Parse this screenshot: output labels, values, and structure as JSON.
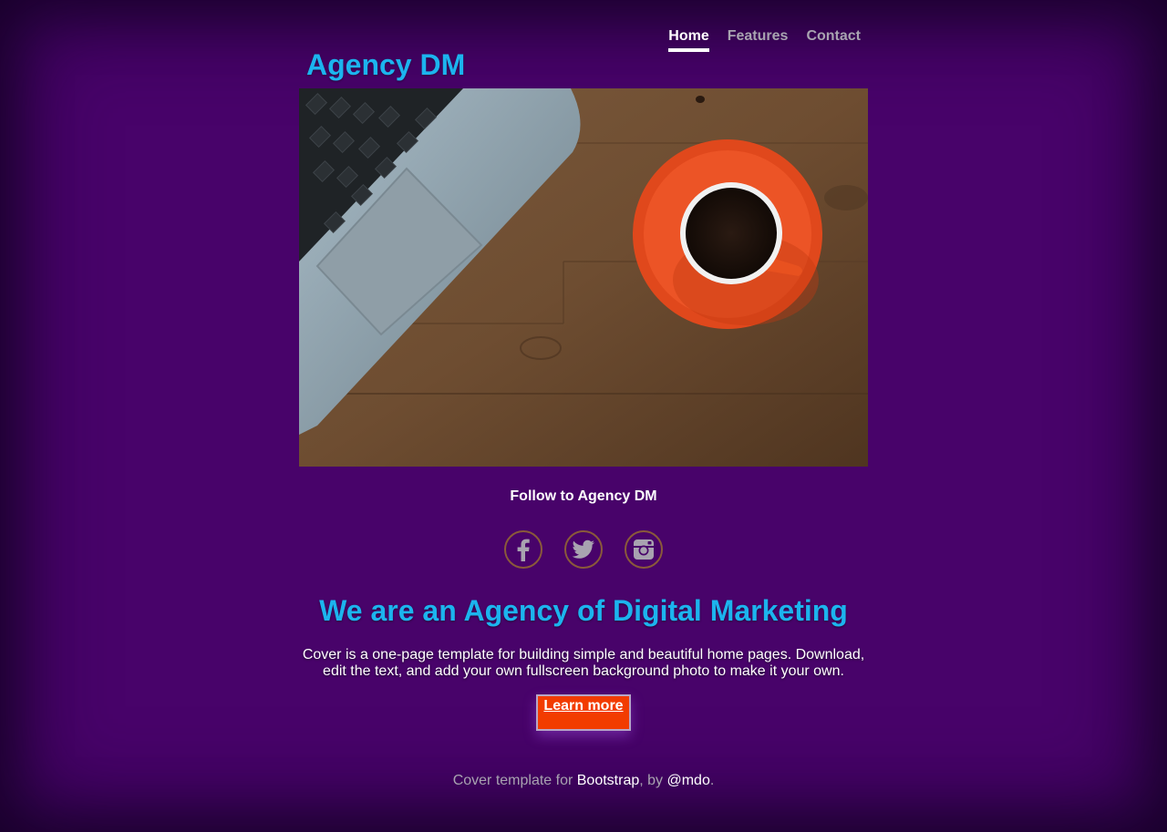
{
  "brand": {
    "name": "Agency DM",
    "color": "#1cb4ee"
  },
  "nav": {
    "items": [
      {
        "label": "Home",
        "active": true
      },
      {
        "label": "Features",
        "active": false
      },
      {
        "label": "Contact",
        "active": false
      }
    ]
  },
  "hero": {
    "image_description_icon": "laptop-coffee-photo"
  },
  "follow": {
    "text": "Follow to Agency DM",
    "social": [
      {
        "name": "facebook-icon"
      },
      {
        "name": "twitter-icon"
      },
      {
        "name": "instagram-icon"
      }
    ]
  },
  "main": {
    "headline": "We are an Agency of Digital Marketing",
    "lead": "Cover is a one-page template for building simple and beautiful home pages. Download, edit the text, and add your own fullscreen background photo to make it your own.",
    "cta_label": "Learn more",
    "cta_color": "#f23c00"
  },
  "footer": {
    "prefix": "Cover template for ",
    "link1": "Bootstrap",
    "middle": ", by ",
    "link2": "@mdo",
    "suffix": "."
  },
  "colors": {
    "background": "#48036a",
    "text": "#ffffff",
    "muted": "#a8a3b0"
  }
}
